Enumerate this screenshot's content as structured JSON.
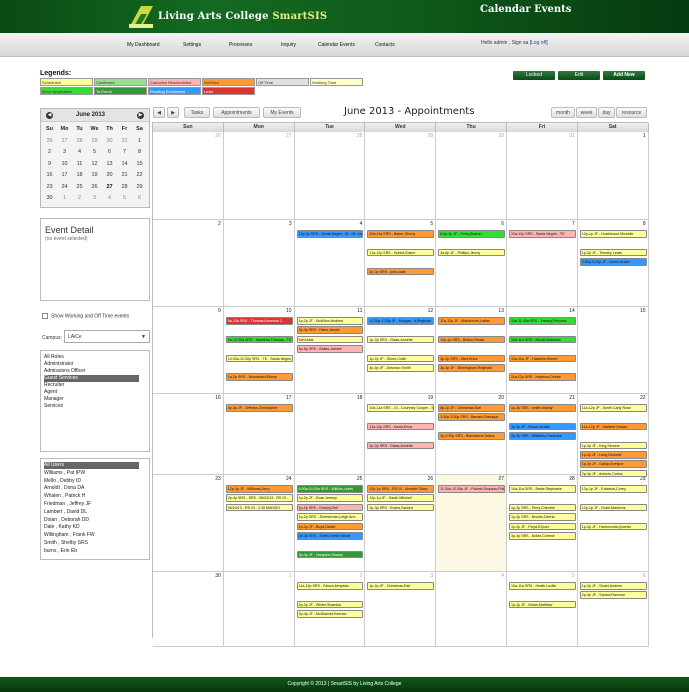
{
  "header": {
    "college": "Living Arts College",
    "product": "SmartSIS",
    "page_title": "Calendar Events"
  },
  "nav": {
    "items": [
      "My Dashboard",
      "Settings",
      "Processes",
      "Inquiry",
      "Calendar Events",
      "Contacts"
    ],
    "greeting": "Hello admin , Sign sa [",
    "logoff": "Log off",
    "greeting_end": "]"
  },
  "legends": {
    "title": "Legends:",
    "items": [
      {
        "label": "Scheduled",
        "color": "#ffff99"
      },
      {
        "label": "Confirmed",
        "color": "#99dd99"
      },
      {
        "label": "Canceled Rescheduled",
        "color": "#ffb3b3"
      },
      {
        "label": "NoShow",
        "color": "#ff9933"
      },
      {
        "label": "Off Time",
        "color": "#e0e0e0"
      },
      {
        "label": "Working Time",
        "color": "#ffffcc"
      },
      {
        "label": "Move Application",
        "color": "#33dd33"
      },
      {
        "label": "To Enroll",
        "color": "#339933"
      },
      {
        "label": "Pending Enrollment",
        "color": "#3399ff"
      },
      {
        "label": "Lead",
        "color": "#dd3333"
      }
    ]
  },
  "top_buttons": {
    "locked": "Locked",
    "edit": "Edit",
    "add_new": "Add New"
  },
  "mini_calendar": {
    "title": "June 2013",
    "weekdays": [
      "Su",
      "Mo",
      "Tu",
      "We",
      "Th",
      "Fr",
      "Sa"
    ],
    "weeks": [
      [
        "26",
        "27",
        "28",
        "29",
        "30",
        "31",
        "1"
      ],
      [
        "2",
        "3",
        "4",
        "5",
        "6",
        "7",
        "8"
      ],
      [
        "9",
        "10",
        "11",
        "12",
        "13",
        "14",
        "15"
      ],
      [
        "16",
        "17",
        "18",
        "19",
        "20",
        "21",
        "22"
      ],
      [
        "23",
        "24",
        "25",
        "26",
        "27",
        "28",
        "29"
      ],
      [
        "30",
        "1",
        "2",
        "3",
        "4",
        "5",
        "6"
      ]
    ]
  },
  "event_detail": {
    "title": "Event Detail",
    "subtitle": "(no event selected)"
  },
  "filters": {
    "show_working": "Show Working and Off Time events",
    "campus_label": "Campus:",
    "campus_value": "LAiCe"
  },
  "roles": [
    "All Roles",
    "Administrator",
    "Admissions Officer",
    "Guest Services",
    "Recruiter",
    "Agent",
    "Manager",
    "Services"
  ],
  "users": [
    "All Users",
    "Williams , Pat IPW",
    "Mello , Debby ID",
    "Arnoldt , Dona DA",
    "Whalen , Patrick H",
    "Friedman , Jeffrey JF",
    "Lambert , David DL",
    "Dolan , Deborah DD",
    "Dale , Kathy KD",
    "Willingham , Frank FW",
    "Smith , Shelby SRS",
    "burns , Erin Eb"
  ],
  "calendar": {
    "title": "June 2013 - Appointments",
    "tabs": [
      "Tasks",
      "Appointments",
      "My Events"
    ],
    "views": [
      "month",
      "week",
      "day",
      "resource"
    ],
    "weekdays": [
      "Sun",
      "Mon",
      "Tue",
      "Wed",
      "Thu",
      "Fri",
      "Sat"
    ],
    "weeks": [
      [
        "26",
        "27",
        "28",
        "29",
        "30",
        "31",
        "1"
      ],
      [
        "2",
        "3",
        "4",
        "5",
        "6",
        "7",
        "8"
      ],
      [
        "9",
        "10",
        "11",
        "12",
        "13",
        "14",
        "15"
      ],
      [
        "16",
        "17",
        "18",
        "19",
        "20",
        "21",
        "22"
      ],
      [
        "23",
        "24",
        "25",
        "26",
        "27",
        "28",
        "29"
      ],
      [
        "30",
        "1",
        "2",
        "3",
        "4",
        "5",
        "6"
      ]
    ],
    "events": [
      {
        "w": 1,
        "d": 2,
        "r": 0,
        "t": "12p-2p SRS - Santa Negrin, 18 - Mt. Installed",
        "c": "#3399ff"
      },
      {
        "w": 1,
        "d": 3,
        "r": 0,
        "t": "10a-11a SRS - Baker, Ebony",
        "c": "#ff9933"
      },
      {
        "w": 1,
        "d": 3,
        "r": 2,
        "t": "11a-12p SRS - Hobbs,Elaine",
        "c": "#ffff99"
      },
      {
        "w": 1,
        "d": 3,
        "r": 4,
        "t": "2p-3p SRS - john,sade",
        "c": "#ff9933"
      },
      {
        "w": 1,
        "d": 4,
        "r": 0,
        "t": "8:2p-3p JF - Perry,Sharon",
        "c": "#33dd33"
      },
      {
        "w": 1,
        "d": 4,
        "r": 2,
        "t": "3a-8p JF - Phillips,Jimmy",
        "c": "#ffff99"
      },
      {
        "w": 1,
        "d": 5,
        "r": 0,
        "t": "10a-12p SRS - Santa Negrin - TE",
        "c": "#ffb3b3"
      },
      {
        "w": 1,
        "d": 6,
        "r": 0,
        "t": "12p-1p JF - Hutchinson,Michelle",
        "c": "#ffff99"
      },
      {
        "w": 1,
        "d": 6,
        "r": 2,
        "t": "1p-2p JF - Timothy Lewis",
        "c": "#ffff99"
      },
      {
        "w": 1,
        "d": 6,
        "r": 3,
        "t": "2:30p-3:30p JF - Green,Andre",
        "c": "#3399ff"
      },
      {
        "w": 2,
        "d": 1,
        "r": 0,
        "t": "9a-10a SRS - Thomas,Kanesha C.",
        "c": "#dd3333"
      },
      {
        "w": 2,
        "d": 1,
        "r": 2,
        "t": "9a-10:30a SRS - Kanesha Thomas - TE",
        "c": "#33dd33"
      },
      {
        "w": 2,
        "d": 1,
        "r": 4,
        "t": "10:30a-12:30p SRS - TE - Santa Negrin, Med Assts",
        "c": "#ffff99"
      },
      {
        "w": 2,
        "d": 1,
        "r": 6,
        "t": "1p-2p SRS - Woodward,Ebony",
        "c": "#ff9933"
      },
      {
        "w": 2,
        "d": 2,
        "r": 0,
        "t": "1p-2p JF - McMhun,Andrew",
        "c": "#ffff99"
      },
      {
        "w": 2,
        "d": 2,
        "r": 1,
        "t": "2p-4p SRS - Hann,James",
        "c": "#ff9933"
      },
      {
        "w": 2,
        "d": 2,
        "r": 2,
        "t": "Med Asst",
        "c": "#ffff99"
      },
      {
        "w": 2,
        "d": 2,
        "r": 3,
        "t": "4p-5p SRS - Bullas,Jaimee",
        "c": "#ffb3b3"
      },
      {
        "w": 2,
        "d": 3,
        "r": 0,
        "t": "12:30p-1:30p JF - Morgan, Jr,Reginald",
        "c": "#3399ff"
      },
      {
        "w": 2,
        "d": 3,
        "r": 2,
        "t": "1p-2p SRS - Glass,Annette",
        "c": "#ffff99"
      },
      {
        "w": 2,
        "d": 3,
        "r": 4,
        "t": "1p-2p JF - Shore,Collin",
        "c": "#ffff99"
      },
      {
        "w": 2,
        "d": 3,
        "r": 5,
        "t": "4p-5p JF - Almonzo Smith",
        "c": "#ffff99"
      },
      {
        "w": 2,
        "d": 4,
        "r": 0,
        "t": "11a-12p JF - Mahdioche,Laftan",
        "c": "#ff9933"
      },
      {
        "w": 2,
        "d": 4,
        "r": 2,
        "t": "12p-1p SRS - Bolton,Pelata",
        "c": "#ff9933"
      },
      {
        "w": 2,
        "d": 4,
        "r": 4,
        "t": "2p-3p SRS - Mert,Erica",
        "c": "#ff9933"
      },
      {
        "w": 2,
        "d": 4,
        "r": 5,
        "t": "3p-4p JF - Birmingham,Reginald",
        "c": "#ff9933"
      },
      {
        "w": 2,
        "d": 5,
        "r": 0,
        "t": "10a-11:30a SRS - Yansey,Princess",
        "c": "#33dd33"
      },
      {
        "w": 2,
        "d": 5,
        "r": 2,
        "t": "10a-11a SRS - Nicole,Nakesha",
        "c": "#33dd33"
      },
      {
        "w": 2,
        "d": 5,
        "r": 4,
        "t": "10a-11a JF - Hawkins,Robert",
        "c": "#ff9933"
      },
      {
        "w": 2,
        "d": 5,
        "r": 6,
        "t": "11a-12p SRS - Hepburn,Deidre",
        "c": "#ff9933"
      },
      {
        "w": 3,
        "d": 1,
        "r": 0,
        "t": "4p-5p JF - Jeffreys,Christopher",
        "c": "#ff9933"
      },
      {
        "w": 3,
        "d": 3,
        "r": 0,
        "t": "10a-11a SRS - GI - Courtney Cooper - MBCE",
        "c": "#ffff99"
      },
      {
        "w": 3,
        "d": 3,
        "r": 2,
        "t": "11a-12p SRS - Kavia,Erica",
        "c": "#ffb3b3"
      },
      {
        "w": 3,
        "d": 3,
        "r": 4,
        "t": "1p-2p SRS - Glass,Annette",
        "c": "#ffb3b3"
      },
      {
        "w": 3,
        "d": 4,
        "r": 0,
        "t": "8p-2p JF - Christmas,Earl",
        "c": "#ff9933"
      },
      {
        "w": 3,
        "d": 4,
        "r": 1,
        "t": "3:30p-3:30p SRS - Barnes,Shanique",
        "c": "#ff9933"
      },
      {
        "w": 3,
        "d": 4,
        "r": 3,
        "t": "3p-3:30p SRS - Blackstone,Debra",
        "c": "#ff9933"
      },
      {
        "w": 3,
        "d": 5,
        "r": 0,
        "t": "1p-2p SRS - smith,chasity",
        "c": "#ff9933"
      },
      {
        "w": 3,
        "d": 5,
        "r": 2,
        "t": "1p-2p JF - Bryan,Jordan",
        "c": "#3399ff"
      },
      {
        "w": 3,
        "d": 5,
        "r": 3,
        "t": "2p-3p SRS - Williams,Cheantha",
        "c": "#3399ff"
      },
      {
        "w": 3,
        "d": 6,
        "r": 0,
        "t": "11a-12p JF - Smith,Carly Rose",
        "c": "#ffff99"
      },
      {
        "w": 3,
        "d": 6,
        "r": 2,
        "t": "11a-12p JF - Mallette,Kasian",
        "c": "#ff9933"
      },
      {
        "w": 3,
        "d": 6,
        "r": 4,
        "t": "1p-2p JF - King,Simone",
        "c": "#ffff99"
      },
      {
        "w": 3,
        "d": 6,
        "r": 5,
        "t": "1p-2p JF - Long,Devonte",
        "c": "#ff9933"
      },
      {
        "w": 3,
        "d": 6,
        "r": 6,
        "t": "1p-2p JF - Gallop,Evelyne",
        "c": "#ff9933"
      },
      {
        "w": 3,
        "d": 6,
        "r": 7,
        "t": "2p-3p JF - Antonio,Carlos",
        "c": "#ffff99"
      },
      {
        "w": 4,
        "d": 1,
        "r": 0,
        "t": "12p-1p JF - Williams,Jerry",
        "c": "#ff9933"
      },
      {
        "w": 4,
        "d": 1,
        "r": 1,
        "t": "2p-4p SRS - SRS - 06/24/13 - RS GI -",
        "c": "#ffff99"
      },
      {
        "w": 4,
        "d": 1,
        "r": 2,
        "t": "06/24/13 - RS GI - 2:30 MADISO",
        "c": "#ffff99"
      },
      {
        "w": 4,
        "d": 2,
        "r": 0,
        "t": "9:30a-10:30a SRS - Wilkins,Lewis",
        "c": "#339933"
      },
      {
        "w": 4,
        "d": 2,
        "r": 1,
        "t": "1p-2p JF - Evan,Jeremy",
        "c": "#ffff99"
      },
      {
        "w": 4,
        "d": 2,
        "r": 2,
        "t": "1p-2p SRS - Dorsey,Dell",
        "c": "#ffb3b3"
      },
      {
        "w": 4,
        "d": 2,
        "r": 3,
        "t": "1p-2p SRS - Zimmerman,Leigh Ann",
        "c": "#ffff99"
      },
      {
        "w": 4,
        "d": 2,
        "r": 4,
        "t": "1p-2p JF - Boyd,Daniel",
        "c": "#ff9933"
      },
      {
        "w": 4,
        "d": 2,
        "r": 5,
        "t": "2p-3p SRS - Smith,Yvette Nicole",
        "c": "#3399ff"
      },
      {
        "w": 4,
        "d": 2,
        "r": 7,
        "t": "3p-4p JF - Hampton,Sharon",
        "c": "#339933"
      },
      {
        "w": 4,
        "d": 3,
        "r": 0,
        "t": "12p-1p SRS - RS GI - Annette Glass",
        "c": "#ff9933"
      },
      {
        "w": 4,
        "d": 3,
        "r": 1,
        "t": "12p-1p JF - Sarah Mitchell",
        "c": "#ffff99"
      },
      {
        "w": 4,
        "d": 3,
        "r": 2,
        "t": "2p-3p SRS - Evans,Sandra",
        "c": "#ffff99"
      },
      {
        "w": 4,
        "d": 4,
        "r": 0,
        "t": "11:30a-12:30p JF - Pickett-Simpson,Philip",
        "c": "#ffb3b3"
      },
      {
        "w": 4,
        "d": 5,
        "r": 0,
        "t": "10a-11a SRS - Beale,Stephanie",
        "c": "#ffff99"
      },
      {
        "w": 4,
        "d": 5,
        "r": 2,
        "t": "1p-2p SRS - Perry,Chevelle",
        "c": "#ffff99"
      },
      {
        "w": 4,
        "d": 5,
        "r": 3,
        "t": "1p-2p SRS - Brooks,Debria",
        "c": "#ffff99"
      },
      {
        "w": 4,
        "d": 5,
        "r": 4,
        "t": "1p-2p JF - Floyd,EQuez",
        "c": "#ffff99"
      },
      {
        "w": 4,
        "d": 5,
        "r": 5,
        "t": "3p-4p SRS - Noble,Corinne",
        "c": "#ffff99"
      },
      {
        "w": 4,
        "d": 6,
        "r": 0,
        "t": "12p-1p JF - Edwards,Corey",
        "c": "#ffff99"
      },
      {
        "w": 4,
        "d": 6,
        "r": 2,
        "t": "12p-1p JF - Grant,Markevis",
        "c": "#ffff99"
      },
      {
        "w": 4,
        "d": 6,
        "r": 4,
        "t": "1p-2p JF - Hammonds,Quentin",
        "c": "#ffff99"
      },
      {
        "w": 5,
        "d": 2,
        "r": 0,
        "t": "11a-12p SRS - Faison,kenyada",
        "c": "#ffff99"
      },
      {
        "w": 5,
        "d": 2,
        "r": 2,
        "t": "2p-3p JF - Wilder,Shamika",
        "c": "#ffff99"
      },
      {
        "w": 5,
        "d": 2,
        "r": 3,
        "t": "3p-4p JF - McDiarmid,Keenan",
        "c": "#ffff99"
      },
      {
        "w": 5,
        "d": 3,
        "r": 0,
        "t": "1p-2p JF - Christmas,Earl",
        "c": "#ffff99"
      },
      {
        "w": 5,
        "d": 5,
        "r": 0,
        "t": "10a-11a SRS - Heath,Lucille",
        "c": "#ffff99"
      },
      {
        "w": 5,
        "d": 5,
        "r": 2,
        "t": "1p-2p JF - Nolan,Matthew",
        "c": "#ffff99"
      },
      {
        "w": 5,
        "d": 6,
        "r": 0,
        "t": "1p-2p JF - Stuart,Andrew",
        "c": "#ffff99"
      },
      {
        "w": 5,
        "d": 6,
        "r": 1,
        "t": "2p-3p JF - Santos,Ramone",
        "c": "#ffff99"
      }
    ]
  },
  "footer": {
    "text": "Copyright © 2013 | SmartSIS by Living Arts College"
  }
}
